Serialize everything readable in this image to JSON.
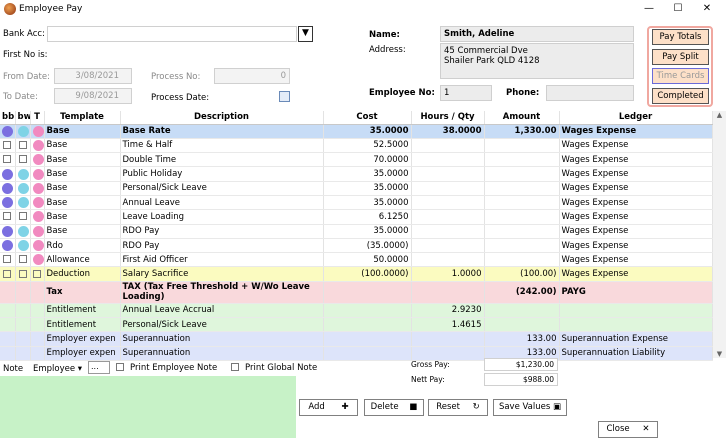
{
  "window": {
    "title": "Employee Pay",
    "minimize": "—",
    "maximize": "☐",
    "close": "✕"
  },
  "form": {
    "bank_acc_label": "Bank Acc:",
    "bank_acc_value": "",
    "first_no_label": "First No is:",
    "from_date_label": "From Date:",
    "from_date": "3/08/2021",
    "to_date_label": "To Date:",
    "to_date": "9/08/2021",
    "process_no_label": "Process No:",
    "process_no": "0",
    "process_date_label": "Process Date:",
    "name_label": "Name:",
    "name": "Smith, Adeline",
    "address_label": "Address:",
    "address_line1": "45 Commercial Dve",
    "address_line2": "Shailer Park QLD 4128",
    "employee_no_label": "Employee No:",
    "employee_no": "1",
    "phone_label": "Phone:",
    "phone": ""
  },
  "side_buttons": {
    "pay_totals": "Pay Totals",
    "pay_split": "Pay Split",
    "time_cards": "Time Cards",
    "completed": "Completed"
  },
  "columns": {
    "bb": "bb",
    "bw": "bw",
    "t": "T",
    "template": "Template",
    "description": "Description",
    "cost": "Cost",
    "hours": "Hours / Qty",
    "amount": "Amount",
    "ledger": "Ledger"
  },
  "rows": [
    {
      "template": "Base",
      "description": "Base Rate",
      "cost": "35.0000",
      "hours": "38.0000",
      "amount": "1,330.00",
      "ledger": "Wages Expense"
    },
    {
      "template": "Base",
      "description": "Time & Half",
      "cost": "52.5000",
      "hours": "",
      "amount": "",
      "ledger": "Wages Expense"
    },
    {
      "template": "Base",
      "description": "Double Time",
      "cost": "70.0000",
      "hours": "",
      "amount": "",
      "ledger": "Wages Expense"
    },
    {
      "template": "Base",
      "description": "Public Holiday",
      "cost": "35.0000",
      "hours": "",
      "amount": "",
      "ledger": "Wages Expense"
    },
    {
      "template": "Base",
      "description": "Personal/Sick Leave",
      "cost": "35.0000",
      "hours": "",
      "amount": "",
      "ledger": "Wages Expense"
    },
    {
      "template": "Base",
      "description": "Annual Leave",
      "cost": "35.0000",
      "hours": "",
      "amount": "",
      "ledger": "Wages Expense"
    },
    {
      "template": "Base",
      "description": "Leave Loading",
      "cost": "6.1250",
      "hours": "",
      "amount": "",
      "ledger": "Wages Expense"
    },
    {
      "template": "Base",
      "description": "RDO Pay",
      "cost": "35.0000",
      "hours": "",
      "amount": "",
      "ledger": "Wages Expense"
    },
    {
      "template": "Rdo",
      "description": "RDO Pay",
      "cost": "(35.0000)",
      "hours": "",
      "amount": "",
      "ledger": "Wages Expense"
    },
    {
      "template": "Allowance",
      "description": "First Aid Officer",
      "cost": "50.0000",
      "hours": "",
      "amount": "",
      "ledger": "Wages Expense"
    },
    {
      "template": "Deduction",
      "description": "Salary Sacrifice",
      "cost": "(100.0000)",
      "hours": "1.0000",
      "amount": "(100.00)",
      "ledger": "Wages Expense"
    },
    {
      "template": "Tax",
      "description": "TAX (Tax Free Threshold  + W/Wo Leave Loading)",
      "cost": "",
      "hours": "",
      "amount": "(242.00)",
      "ledger": "PAYG"
    },
    {
      "template": "Entitlement",
      "description": "Annual Leave Accrual",
      "cost": "",
      "hours": "2.9230",
      "amount": "",
      "ledger": ""
    },
    {
      "template": "Entitlement",
      "description": "Personal/Sick Leave",
      "cost": "",
      "hours": "1.4615",
      "amount": "",
      "ledger": ""
    },
    {
      "template": "Employer expen",
      "description": "Superannuation",
      "cost": "",
      "hours": "",
      "amount": "133.00",
      "ledger": "Superannuation Expense"
    },
    {
      "template": "Employer expen",
      "description": "Superannuation",
      "cost": "",
      "hours": "",
      "amount": "133.00",
      "ledger": "Superannuation Liability"
    }
  ],
  "footer": {
    "note_label": "Note",
    "note_type": "Employee",
    "note_ellipsis": "...",
    "print_employee_note": "Print Employee Note",
    "print_global_note": "Print Global Note",
    "gross_pay_label": "Gross Pay:",
    "gross_pay": "$1,230.00",
    "nett_pay_label": "Nett Pay:",
    "nett_pay": "$988.00",
    "add": "Add",
    "delete": "Delete",
    "reset": "Reset",
    "save_values": "Save Values",
    "close": "Close"
  },
  "colors": {
    "highlight": "#c7dcf6",
    "deduction": "#fbfbc0",
    "tax": "#f9d9dc",
    "entitlement": "#dff6dc",
    "employer": "#dde4fa",
    "note_area": "#c7f2c7"
  }
}
